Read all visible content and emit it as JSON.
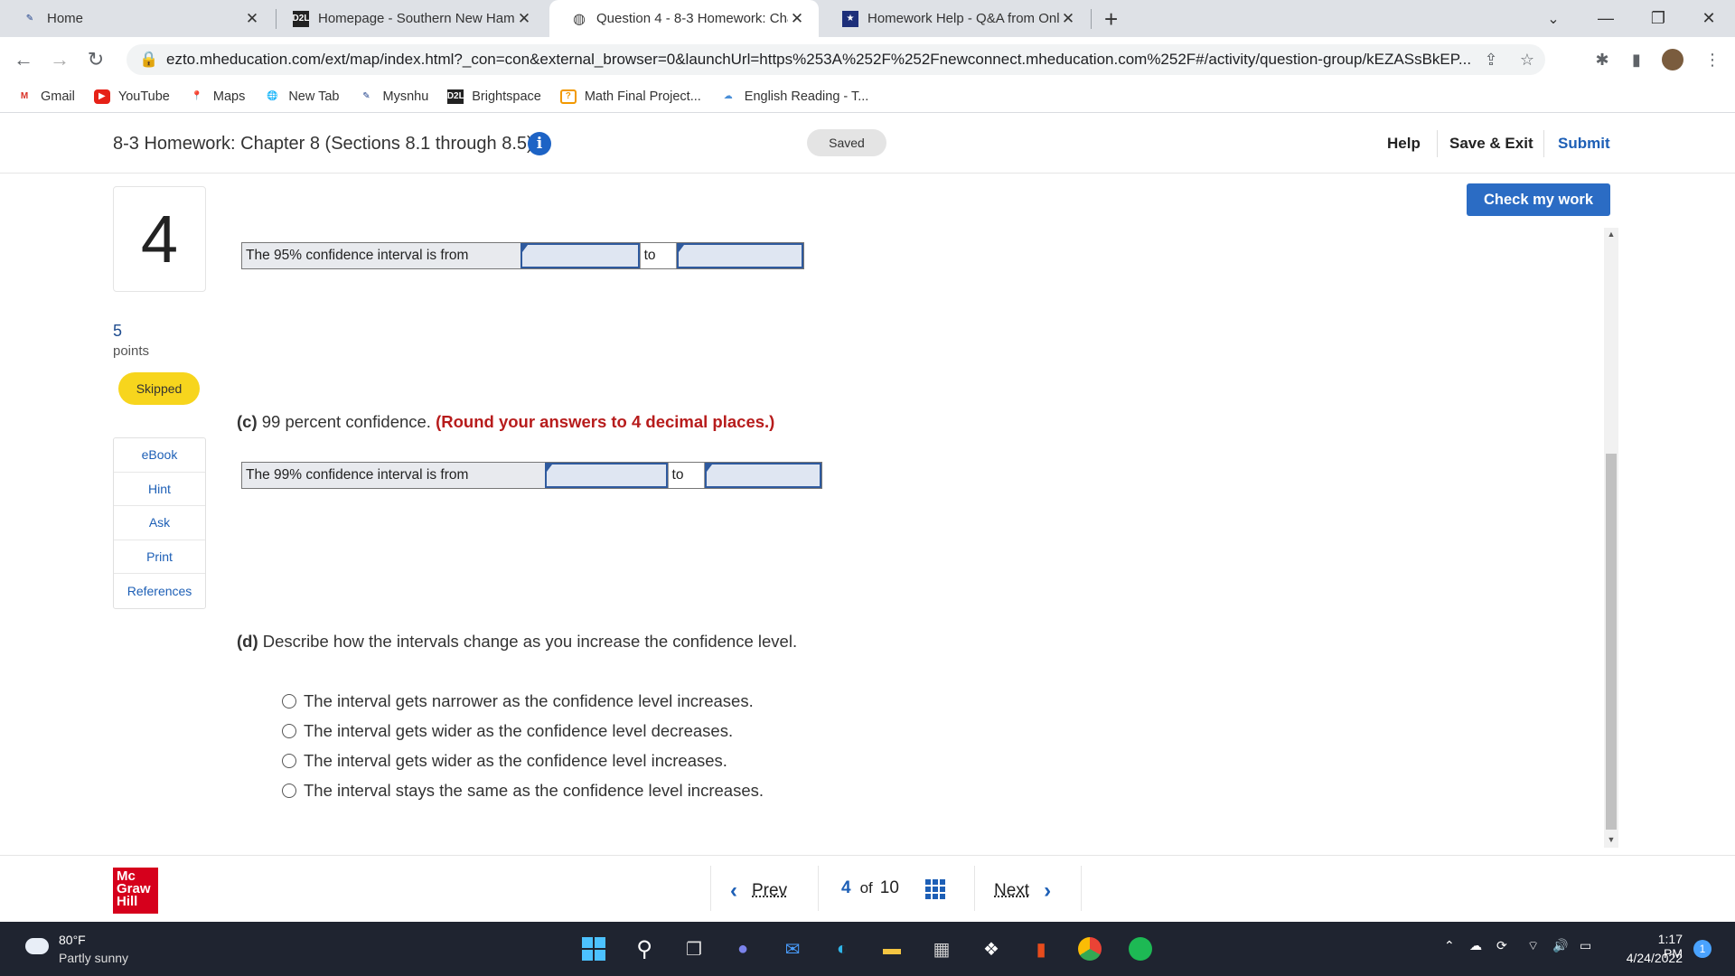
{
  "browser": {
    "tabs": [
      {
        "title": "Home",
        "icon": "feather-icon"
      },
      {
        "title": "Homepage - Southern New Ham",
        "icon": "d2l-icon",
        "icon_text": "D2L"
      },
      {
        "title": "Question 4 - 8-3 Homework: Cha",
        "icon": "globe-icon"
      },
      {
        "title": "Homework Help - Q&A from Onl",
        "icon": "star-shield-icon"
      }
    ],
    "url": "ezto.mheducation.com/ext/map/index.html?_con=con&external_browser=0&launchUrl=https%253A%252F%252Fnewconnect.mheducation.com%252F#/activity/question-group/kEZASsBkEP...",
    "bookmarks": [
      {
        "label": "Gmail",
        "icon_text": "M"
      },
      {
        "label": "YouTube",
        "icon_text": "▶"
      },
      {
        "label": "Maps",
        "icon_text": "📍"
      },
      {
        "label": "New Tab",
        "icon_text": "🌐"
      },
      {
        "label": "Mysnhu",
        "icon_text": "✎"
      },
      {
        "label": "Brightspace",
        "icon_text": "D2L"
      },
      {
        "label": "Math Final Project...",
        "icon_text": "?"
      },
      {
        "label": "English Reading - T...",
        "icon_text": "☁"
      }
    ]
  },
  "header": {
    "title": "8-3 Homework: Chapter 8 (Sections 8.1 through 8.5)",
    "status": "Saved",
    "help": "Help",
    "save_exit": "Save & Exit",
    "submit": "Submit"
  },
  "question": {
    "number": "4",
    "points_value": "5",
    "points_label": "points",
    "status_badge": "Skipped"
  },
  "tools": [
    "eBook",
    "Hint",
    "Ask",
    "Print",
    "References"
  ],
  "check_work": "Check my work",
  "interval_95": {
    "label": "The 95% confidence interval is from",
    "to": "to",
    "low": "",
    "high": ""
  },
  "part_c": {
    "letter": "(c)",
    "text": " 99 percent confidence. ",
    "note": "(Round your answers to 4 decimal places.)"
  },
  "interval_99": {
    "label": "The 99% confidence interval is from",
    "to": "to",
    "low": "",
    "high": ""
  },
  "part_d": {
    "letter": "(d)",
    "text": " Describe how the intervals change as you increase the confidence level."
  },
  "options": [
    "The interval gets narrower as the confidence level increases.",
    "The interval gets wider as the confidence level decreases.",
    "The interval gets wider as the confidence level increases.",
    "The interval stays the same as the confidence level increases."
  ],
  "footer": {
    "logo": [
      "Mc",
      "Graw",
      "Hill"
    ],
    "prev": "Prev",
    "current": "4",
    "of": "of",
    "total": "10",
    "next": "Next"
  },
  "taskbar": {
    "temp": "80°F",
    "weather": "Partly sunny",
    "time": "1:17 PM",
    "date": "4/24/2022",
    "notifications": "1"
  }
}
